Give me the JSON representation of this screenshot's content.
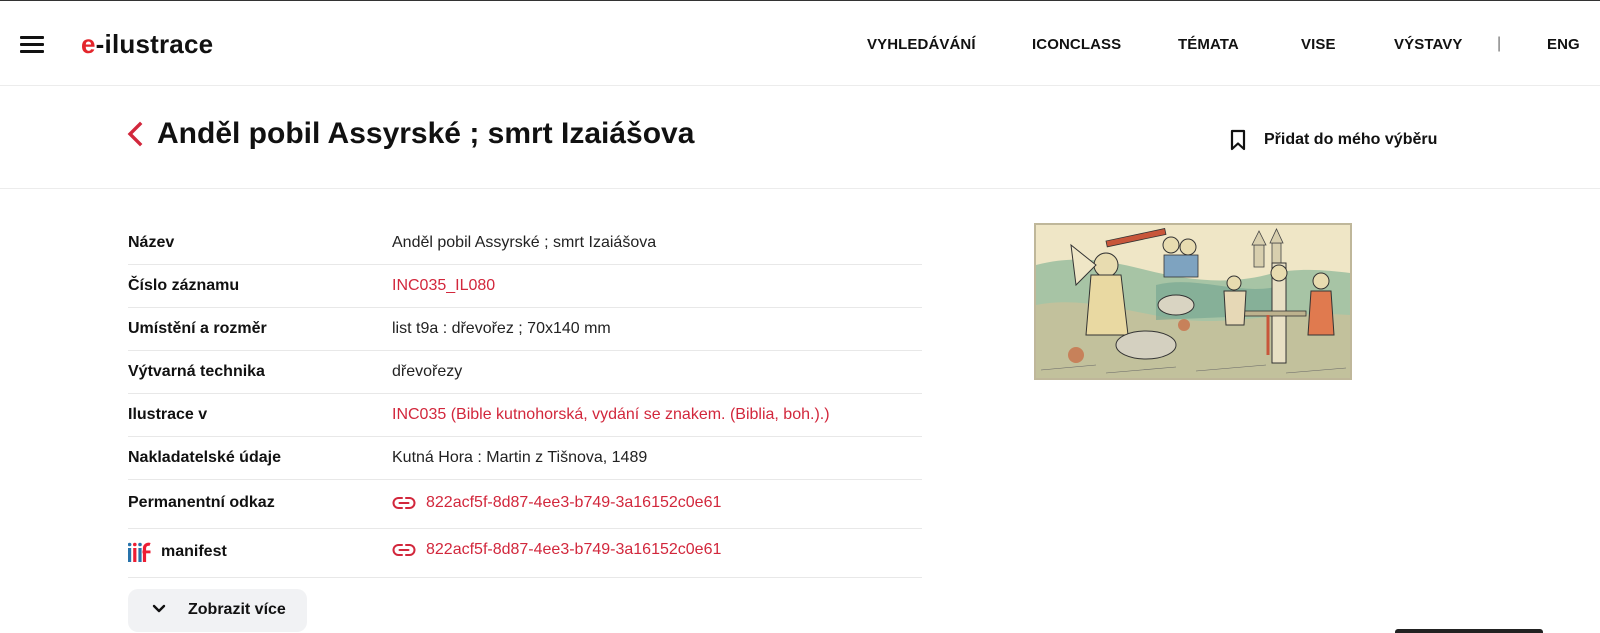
{
  "header": {
    "logo_e": "e",
    "logo_rest": "-ilustrace",
    "nav": [
      {
        "label": "VYHLEDÁVÁNÍ"
      },
      {
        "label": "ICONCLASS"
      },
      {
        "label": "TÉMATA"
      },
      {
        "label": "VISE"
      },
      {
        "label": "VÝSTAVY"
      }
    ],
    "separator": "|",
    "lang": "ENG"
  },
  "titlebar": {
    "title": "Anděl pobil Assyrské ; smrt Izaiášova",
    "bookmark_label": "Přidat do mého výběru"
  },
  "metadata": [
    {
      "label": "Název",
      "value": "Anděl pobil Assyrské ; smrt Izaiášova",
      "link": false
    },
    {
      "label": "Číslo záznamu",
      "value": "INC035_IL080",
      "link": true
    },
    {
      "label": "Umístění a rozměr",
      "value": "list t9a : dřevořez ; 70x140 mm",
      "link": false
    },
    {
      "label": "Výtvarná technika",
      "value": "dřevořezy",
      "link": false
    },
    {
      "label": "Ilustrace v",
      "value": "INC035 (Bible kutnohorská, vydání se znakem. (Biblia, boh.).)",
      "link": true
    },
    {
      "label": "Nakladatelské údaje",
      "value": "Kutná Hora : Martin z Tišnova, 1489",
      "link": false
    },
    {
      "label": "Permanentní odkaz",
      "value": "822acf5f-8d87-4ee3-b749-3a16152c0e61",
      "link": true
    },
    {
      "label": "manifest",
      "value": "822acf5f-8d87-4ee3-b749-3a16152c0e61",
      "link": true
    }
  ],
  "show_more_label": "Zobrazit více",
  "colors": {
    "accent": "#d2273c",
    "logo_red": "#e3262c",
    "text": "#111111",
    "divider": "#e8e8e8",
    "button_bg": "#f1f2f4"
  },
  "icons": {
    "menu": "hamburger-menu-icon",
    "back": "chevron-left-icon",
    "bookmark": "bookmark-icon",
    "link": "link-icon",
    "iiif": "iiif-logo-icon",
    "expand": "chevron-down-icon"
  }
}
